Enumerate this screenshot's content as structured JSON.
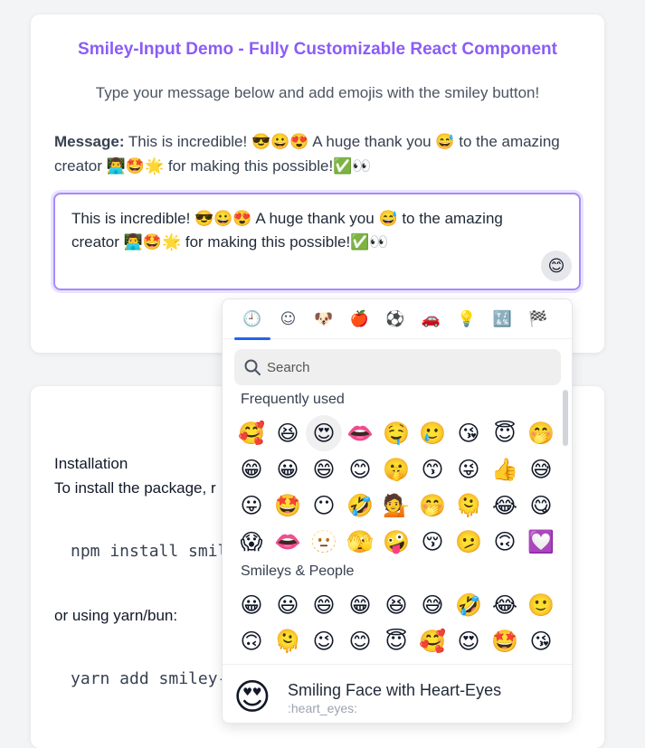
{
  "card1": {
    "title": "Smiley-Input Demo - Fully Customizable React Component",
    "subtitle": "Type your message below and add emojis with the smiley button!",
    "message_label": "Message:",
    "message_line1": " This is incredible! 😎😀😍 A huge thank you 😅 to the amazing",
    "message_line2": "creator 👨‍💻🤩🌟 for making this possible!✅👀",
    "input_line1": "This is incredible! 😎😀😍 A huge thank you 😅 to the amazing",
    "input_line2": "creator 👨‍💻🤩🌟 for making this possible!✅👀",
    "smiley_button": "😊"
  },
  "card2": {
    "installation": "Installation",
    "install_text": "To install the package, r",
    "npm_cmd": "npm install smil",
    "or_text": "or using yarn/bun:",
    "yarn_cmd": "yarn add smiley-"
  },
  "picker": {
    "categories": [
      {
        "name": "recent",
        "glyph": "🕘"
      },
      {
        "name": "smileys",
        "glyph": "☺"
      },
      {
        "name": "animals",
        "glyph": "🐶"
      },
      {
        "name": "food",
        "glyph": "🍎"
      },
      {
        "name": "activity",
        "glyph": "⚽"
      },
      {
        "name": "travel",
        "glyph": "🚗"
      },
      {
        "name": "objects",
        "glyph": "💡"
      },
      {
        "name": "symbols",
        "glyph": "🔣"
      },
      {
        "name": "flags",
        "glyph": "🏁"
      }
    ],
    "search_placeholder": "Search",
    "frequent_title": "Frequently used",
    "frequent": [
      "🥰",
      "😆",
      "😍",
      "👄",
      "🤤",
      "🥲",
      "😘",
      "😇",
      "🤭",
      "😁",
      "😀",
      "😄",
      "😊",
      "🤫",
      "😙",
      "😜",
      "👍",
      "😅",
      "😛",
      "🤩",
      "😶",
      "🤣",
      "💁",
      "🤭",
      "🫠",
      "😂",
      "😋",
      "😱",
      "👄",
      "🫥",
      "🫣",
      "🤪",
      "😚",
      "🫤",
      "🙃",
      "💟"
    ],
    "smileys_title": "Smileys & People",
    "smileys": [
      "😀",
      "😃",
      "😄",
      "😁",
      "😆",
      "😅",
      "🤣",
      "😂",
      "🙂",
      "🙃",
      "🫠",
      "😉",
      "😊",
      "😇",
      "🥰",
      "😍",
      "🤩",
      "😘"
    ],
    "preview_emoji": "😍",
    "preview_name": "Smiling Face with Heart-Eyes",
    "preview_code": ":heart_eyes:"
  },
  "colors": {
    "title": "#8b5cf6",
    "active_tab": "#2563eb",
    "input_border": "#a78bfa"
  }
}
